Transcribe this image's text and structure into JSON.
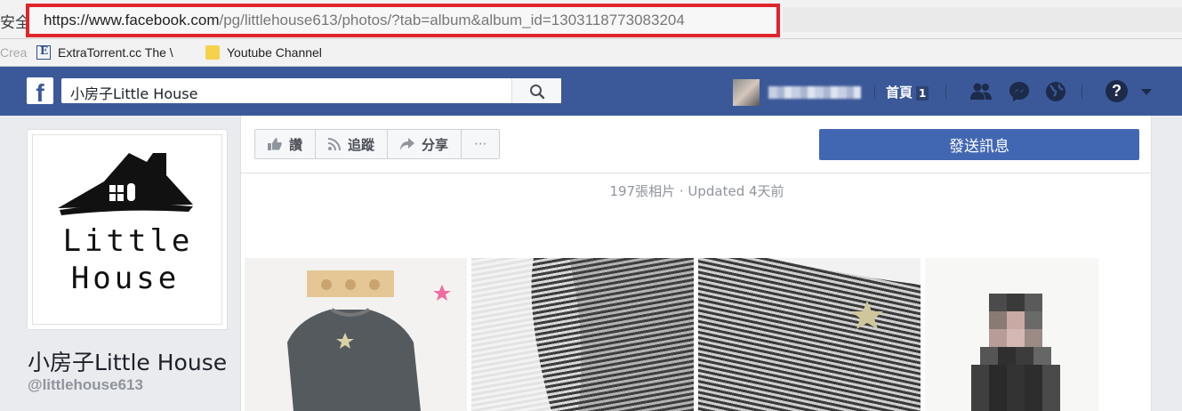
{
  "browser": {
    "secure_label": "安全",
    "url_host": "https://www.facebook.com",
    "url_path": "/pg/littlehouse613/photos/?tab=album&album_id=1303118773083204",
    "bookmarks": [
      {
        "label": "Crea",
        "icon": "page-icon"
      },
      {
        "label": "ExtraTorrent.cc The \\",
        "icon": "extratorrent-icon"
      },
      {
        "label": "Youtube Channel",
        "icon": "folder-icon"
      }
    ]
  },
  "facebook": {
    "search_value": "小房子Little House",
    "home_label": "首頁",
    "home_count": "1",
    "help_glyph": "?"
  },
  "page": {
    "name": "小房子Little House",
    "handle": "@littlehouse613",
    "logo_text_line1": "Little",
    "logo_text_line2": "House"
  },
  "actions": {
    "like": "讚",
    "follow": "追蹤",
    "share": "分享",
    "more": "···",
    "message": "發送訊息"
  },
  "album": {
    "meta": "197張相片 · Updated 4天前"
  },
  "colors": {
    "facebook_blue": "#3b5998",
    "message_button": "#4267b2",
    "highlight_red": "#e0242b"
  }
}
